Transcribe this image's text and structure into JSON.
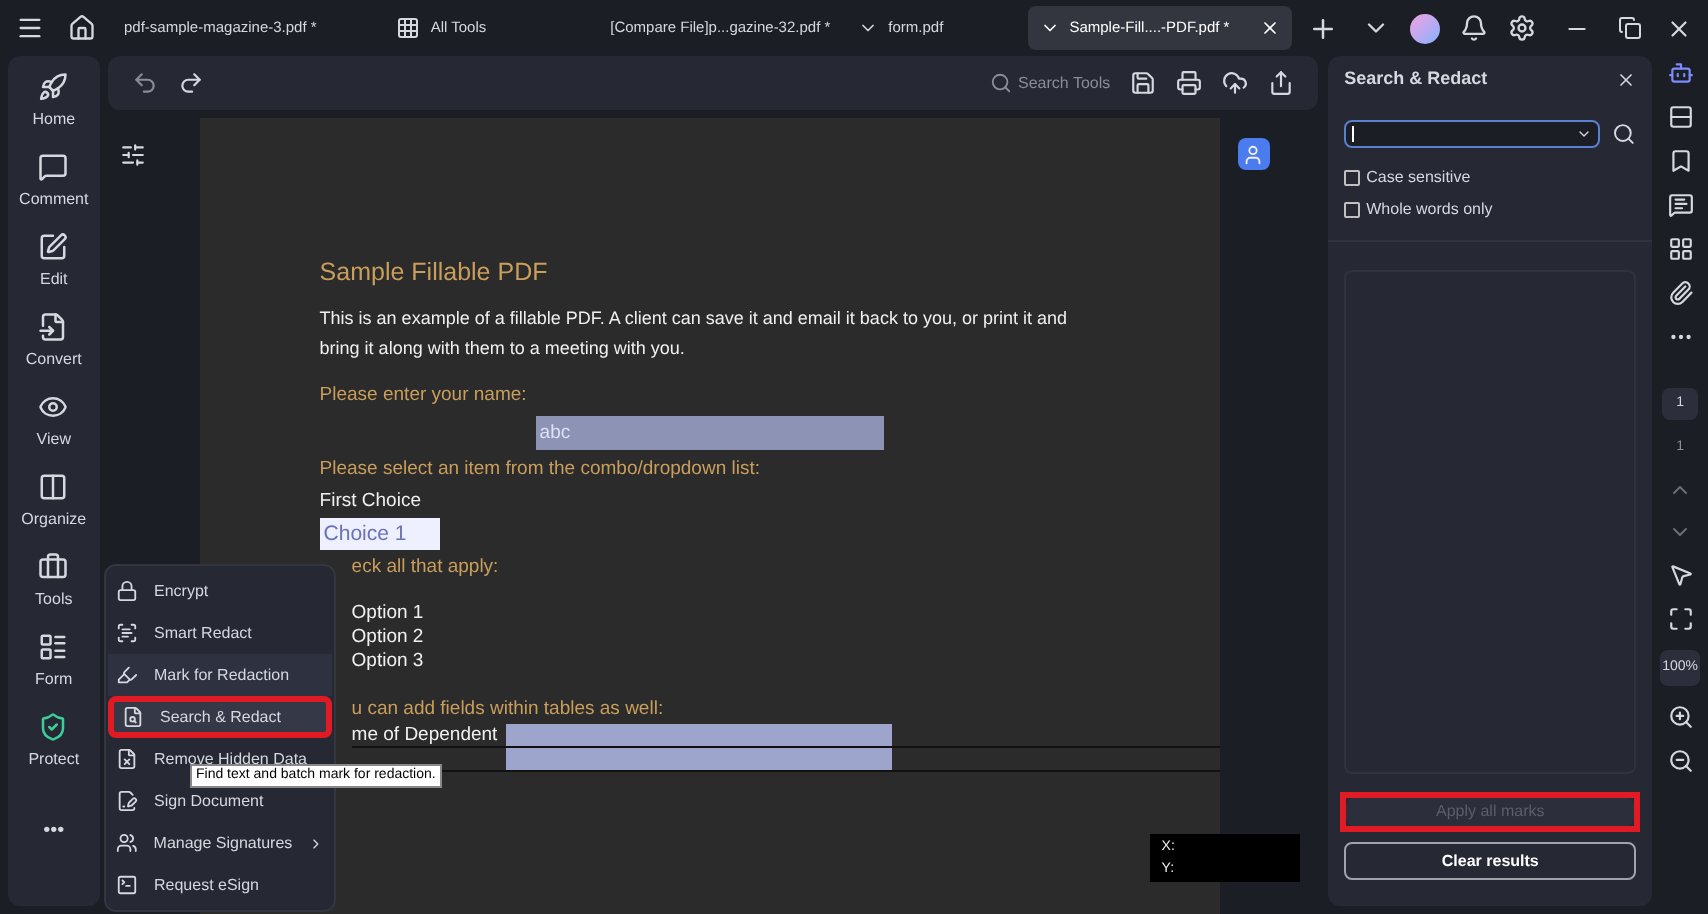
{
  "tabs": [
    {
      "label": "pdf-sample-magazine-3.pdf *",
      "kind": "file",
      "selected": false
    },
    {
      "label": "All Tools",
      "kind": "tools",
      "selected": false
    },
    {
      "label": "[Compare  File]p...gazine-32.pdf *",
      "kind": "file",
      "selected": false
    },
    {
      "label": "form.pdf",
      "kind": "file",
      "selected": false
    },
    {
      "label": "Sample-Fill....-PDF.pdf *",
      "kind": "file",
      "selected": true
    }
  ],
  "nav": [
    {
      "label": "Home",
      "kind": "home"
    },
    {
      "label": "Comment",
      "kind": "comment"
    },
    {
      "label": "Edit",
      "kind": "edit"
    },
    {
      "label": "Convert",
      "kind": "convert"
    },
    {
      "label": "View",
      "kind": "view"
    },
    {
      "label": "Organize",
      "kind": "organize"
    },
    {
      "label": "Tools",
      "kind": "tools"
    },
    {
      "label": "Form",
      "kind": "form"
    },
    {
      "label": "Protect",
      "kind": "protect"
    }
  ],
  "nav_more": "•••",
  "toolbar": {
    "search_placeholder": "Search Tools"
  },
  "document": {
    "title": "Sample Fillable PDF",
    "intro": "This is an example of a fillable PDF. A client can save it and email it back to you, or print it and bring it along with them to a meeting with you.",
    "name_label": "Please enter your name:",
    "name_value": "abc",
    "combo_label": "Please select an item from the combo/dropdown list:",
    "combo_caption": "First Choice",
    "combo_value": "Choice 1",
    "check_label": "eck all that apply:",
    "options": [
      "Option 1",
      "Option 2",
      "Option 3"
    ],
    "table_label": "u can add  fields within tables as well:",
    "table_rows": [
      "me of Dependent",
      ""
    ],
    "coords": [
      "X:",
      "Y:"
    ]
  },
  "menu": {
    "items": [
      {
        "label": "Encrypt",
        "kind": "lock",
        "selected": false
      },
      {
        "label": "Smart Redact",
        "kind": "smart",
        "selected": false
      },
      {
        "label": "Mark for Redaction",
        "kind": "mark",
        "selected": false
      },
      {
        "label": "Search & Redact",
        "kind": "search",
        "selected": true
      },
      {
        "label": "Remove Hidden Data",
        "kind": "remove",
        "selected": false
      },
      {
        "label": "Sign Document",
        "kind": "sign",
        "selected": false
      },
      {
        "label": "Manage Signatures",
        "kind": "signatures",
        "selected": false,
        "submenu": true
      },
      {
        "label": "Request eSign",
        "kind": "esign",
        "selected": false
      }
    ],
    "tooltip": "Find text and batch mark for redaction."
  },
  "panel": {
    "title": "Search & Redact",
    "options": [
      {
        "label": "Case sensitive",
        "checked": false
      },
      {
        "label": "Whole words only",
        "checked": false
      }
    ],
    "apply": {
      "label": "Apply all marks",
      "disabled": true
    },
    "clear": "Clear results"
  },
  "rail": {
    "page_current": "1",
    "page_total": "1",
    "zoom": "100%"
  }
}
